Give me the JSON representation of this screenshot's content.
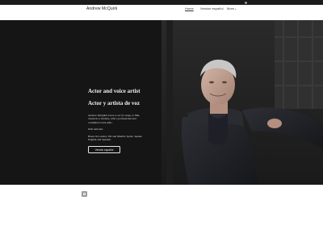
{
  "site": {
    "title": "Andrew McQuirk"
  },
  "nav": {
    "home": "Home",
    "version": "Versión español",
    "more": "More",
    "more_chevron": "⌄"
  },
  "hero": {
    "heading_en": "Actor and voice artist",
    "heading_es": "Actor y artista de voz",
    "paragraphs": [
      "Andrew McQuirk loves to act for stage or film, classical or modern, with a professional and committed work ethic.",
      "Irish national.",
      "Bases in London, UK and Madrid, Spain. Speaks English and Spanish."
    ],
    "cta_label": "Versión español"
  },
  "colors": {
    "hero_bg": "#141414",
    "nav_bg": "#ffffff",
    "text_light": "#f2f2f2"
  }
}
